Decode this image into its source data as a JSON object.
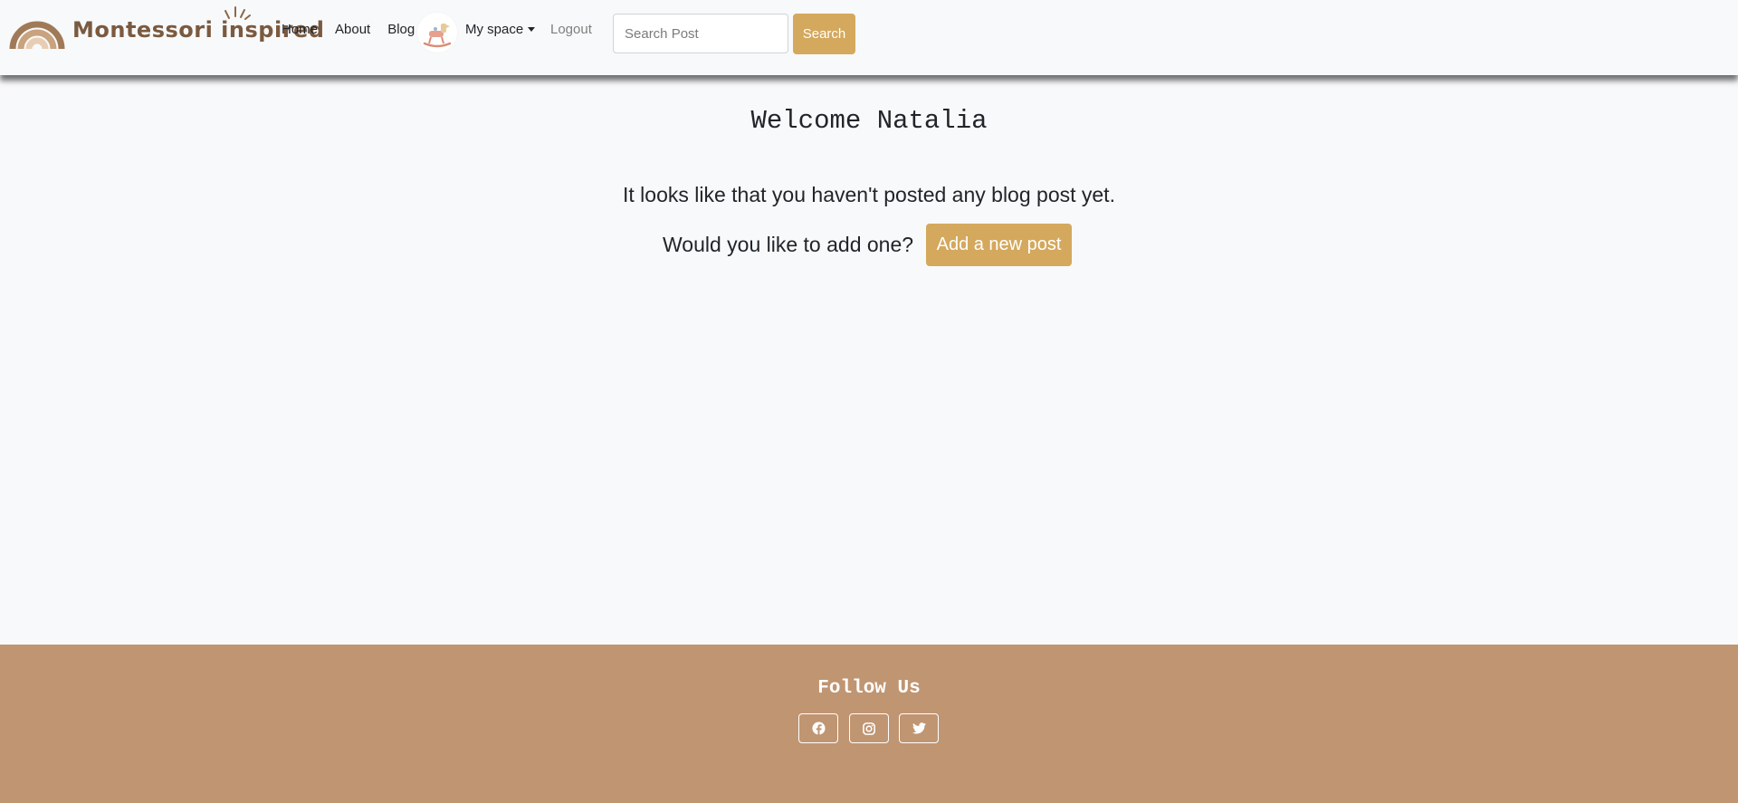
{
  "brand": {
    "name": "Montessori inspired"
  },
  "nav": {
    "links": [
      "Home",
      "About",
      "Blog"
    ],
    "dropdown_label": "My space",
    "logout_label": "Logout"
  },
  "search": {
    "placeholder": "Search Post",
    "value": "",
    "button_label": "Search"
  },
  "main": {
    "welcome": "Welcome Natalia",
    "no_posts_message": "It looks like that you haven't posted any blog post yet.",
    "add_question": "Would you like to add one?",
    "add_button_label": "Add a new post"
  },
  "footer": {
    "heading": "Follow Us",
    "social": [
      "facebook-icon",
      "instagram-icon",
      "twitter-icon"
    ]
  },
  "colors": {
    "accent": "#d4a85d",
    "footer_bg": "#c09572",
    "brand_text": "#7a5a40",
    "page_bg": "#f8f9fa"
  }
}
